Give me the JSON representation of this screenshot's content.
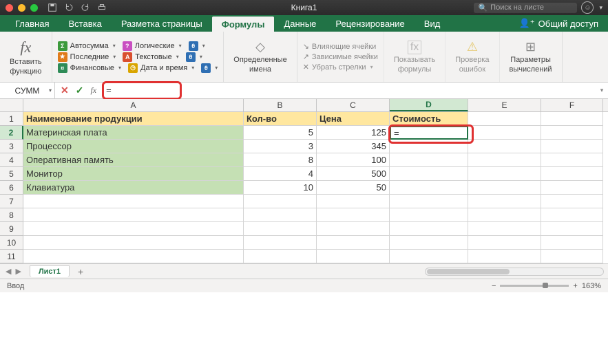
{
  "window": {
    "title": "Книга1",
    "search_placeholder": "Поиск на листе"
  },
  "tabs": {
    "items": [
      "Главная",
      "Вставка",
      "Разметка страницы",
      "Формулы",
      "Данные",
      "Рецензирование",
      "Вид"
    ],
    "active_index": 3,
    "share_label": "Общий доступ"
  },
  "ribbon": {
    "insert_fn_top": "Вставить",
    "insert_fn_bottom": "функцию",
    "func_items": [
      {
        "label": "Автосумма",
        "color": "#3c9a3c",
        "glyph": "Σ"
      },
      {
        "label": "Логические",
        "color": "#c94fc1",
        "glyph": "?"
      },
      {
        "label": "Последние",
        "color": "#e07b1a",
        "glyph": "★"
      },
      {
        "label": "Текстовые",
        "color": "#d94f2f",
        "glyph": "A"
      },
      {
        "label": "Финансовые",
        "color": "#2e8b57",
        "glyph": "¤"
      },
      {
        "label": "Дата и время",
        "color": "#d9a500",
        "glyph": "◷"
      }
    ],
    "extra_sq": [
      "#2f6fb3",
      "#2f6fb3",
      "#2f6fb3"
    ],
    "defined_names_top": "Определенные",
    "defined_names_bottom": "имена",
    "trace": {
      "prec": "Влияющие ячейки",
      "dep": "Зависимые ячейки",
      "remove": "Убрать стрелки"
    },
    "show_formulas_top": "Показывать",
    "show_formulas_bottom": "формулы",
    "check_top": "Проверка",
    "check_bottom": "ошибок",
    "calc_top": "Параметры",
    "calc_bottom": "вычислений"
  },
  "formula_bar": {
    "name_box": "СУММ",
    "formula": "="
  },
  "columns": [
    "A",
    "B",
    "C",
    "D",
    "E",
    "F"
  ],
  "row_count": 11,
  "active": {
    "col": 3,
    "row": 2
  },
  "header_row": [
    "Наименование продукции",
    "Кол-во",
    "Цена",
    "Стоимость"
  ],
  "data_rows": [
    {
      "name": "Материнская плата",
      "qty": 5,
      "price": 125
    },
    {
      "name": "Процессор",
      "qty": 3,
      "price": 345
    },
    {
      "name": "Оперативная память",
      "qty": 8,
      "price": 100
    },
    {
      "name": "Монитор",
      "qty": 4,
      "price": 500
    },
    {
      "name": "Клавиатура",
      "qty": 10,
      "price": 50
    }
  ],
  "editing_value": "=",
  "sheet": {
    "name": "Лист1"
  },
  "status": {
    "mode": "Ввод",
    "zoom": "163%"
  }
}
